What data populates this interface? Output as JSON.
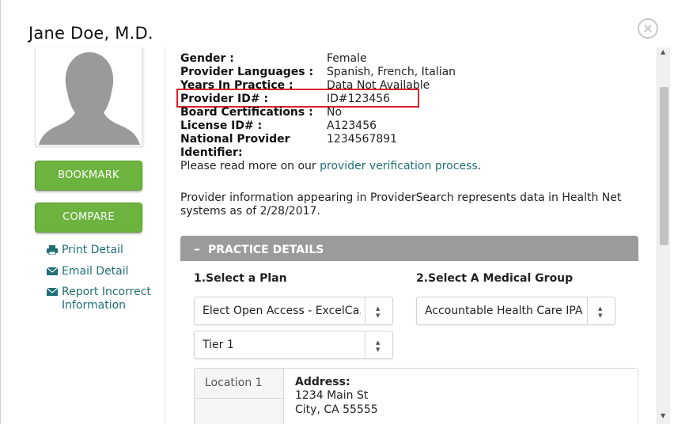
{
  "header": {
    "title": "Jane Doe, M.D."
  },
  "sidebar": {
    "bookmark_label": "BOOKMARK",
    "compare_label": "COMPARE",
    "links": {
      "print": "Print Detail",
      "email": "Email Detail",
      "report_line1": "Report Incorrect",
      "report_line2": "Information"
    }
  },
  "provider": {
    "fields": [
      {
        "label": "Gender :",
        "value": "Female"
      },
      {
        "label": "Provider Languages :",
        "value": "Spanish, French, Italian"
      },
      {
        "label": "Years In Practice :",
        "value": "Data Not Available"
      },
      {
        "label": "Provider ID# :",
        "value": "ID#123456"
      },
      {
        "label": "Board Certifications :",
        "value": "No"
      },
      {
        "label": "License ID# :",
        "value": "A123456"
      },
      {
        "label": "National Provider",
        "value": "1234567891"
      },
      {
        "label": "Identifier:",
        "value": ""
      }
    ],
    "verification_text": "Please read more on our",
    "verification_link": "provider verification process",
    "verification_end": ".",
    "disclaimer_line1": "Provider information appearing in ProviderSearch represents data in Health Net",
    "disclaimer_line2": "systems as of 2/28/2017."
  },
  "practice": {
    "section_title": "PRACTICE DETAILS",
    "plan_label": "1.Select a Plan",
    "group_label": "2.Select A Medical Group",
    "plan_value": "Elect Open Access - ExcelCa...",
    "tier_value": "Tier 1",
    "group_value": "Accountable Health Care IPA",
    "location_tab": "Location 1",
    "address_label": "Address:",
    "address_line1": "1234 Main St",
    "address_line2": "City, CA 55555"
  },
  "colors": {
    "accent_green": "#6db33f",
    "link_teal": "#1f6f74",
    "highlight_red": "#d6242b",
    "section_gray": "#9b9b9b"
  }
}
